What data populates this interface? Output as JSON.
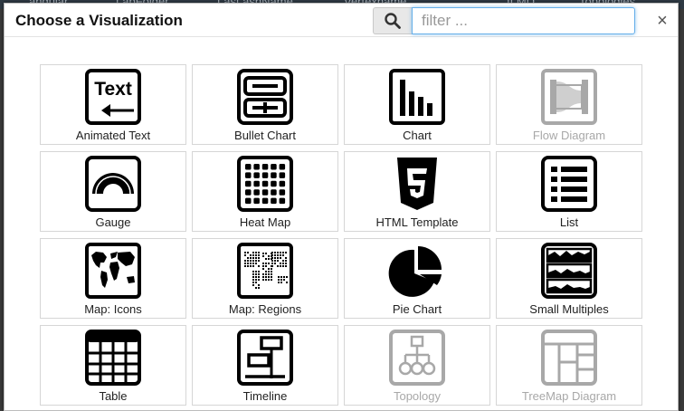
{
  "backdrop": {
    "items": [
      "angular",
      "LabFolder",
      "Last ashName",
      "Vertexname",
      "II MD",
      "Topologies"
    ]
  },
  "dialog": {
    "title": "Choose a Visualization",
    "filter_placeholder": "filter ...",
    "filter_value": "",
    "close_glyph": "×"
  },
  "visualizations": [
    {
      "label": "Animated Text",
      "icon": "animated-text-icon",
      "enabled": true
    },
    {
      "label": "Bullet Chart",
      "icon": "bullet-chart-icon",
      "enabled": true
    },
    {
      "label": "Chart",
      "icon": "bar-chart-icon",
      "enabled": true
    },
    {
      "label": "Flow Diagram",
      "icon": "flow-diagram-icon",
      "enabled": false
    },
    {
      "label": "Gauge",
      "icon": "gauge-icon",
      "enabled": true
    },
    {
      "label": "Heat Map",
      "icon": "heat-map-icon",
      "enabled": true
    },
    {
      "label": "HTML Template",
      "icon": "html5-icon",
      "enabled": true
    },
    {
      "label": "List",
      "icon": "list-icon",
      "enabled": true
    },
    {
      "label": "Map: Icons",
      "icon": "world-map-icon",
      "enabled": true
    },
    {
      "label": "Map: Regions",
      "icon": "world-map-regions-icon",
      "enabled": true
    },
    {
      "label": "Pie Chart",
      "icon": "pie-chart-icon",
      "enabled": true
    },
    {
      "label": "Small Multiples",
      "icon": "small-multiples-icon",
      "enabled": true
    },
    {
      "label": "Table",
      "icon": "table-icon",
      "enabled": true
    },
    {
      "label": "Timeline",
      "icon": "timeline-icon",
      "enabled": true
    },
    {
      "label": "Topology",
      "icon": "topology-icon",
      "enabled": false
    },
    {
      "label": "TreeMap Diagram",
      "icon": "treemap-icon",
      "enabled": false
    }
  ]
}
